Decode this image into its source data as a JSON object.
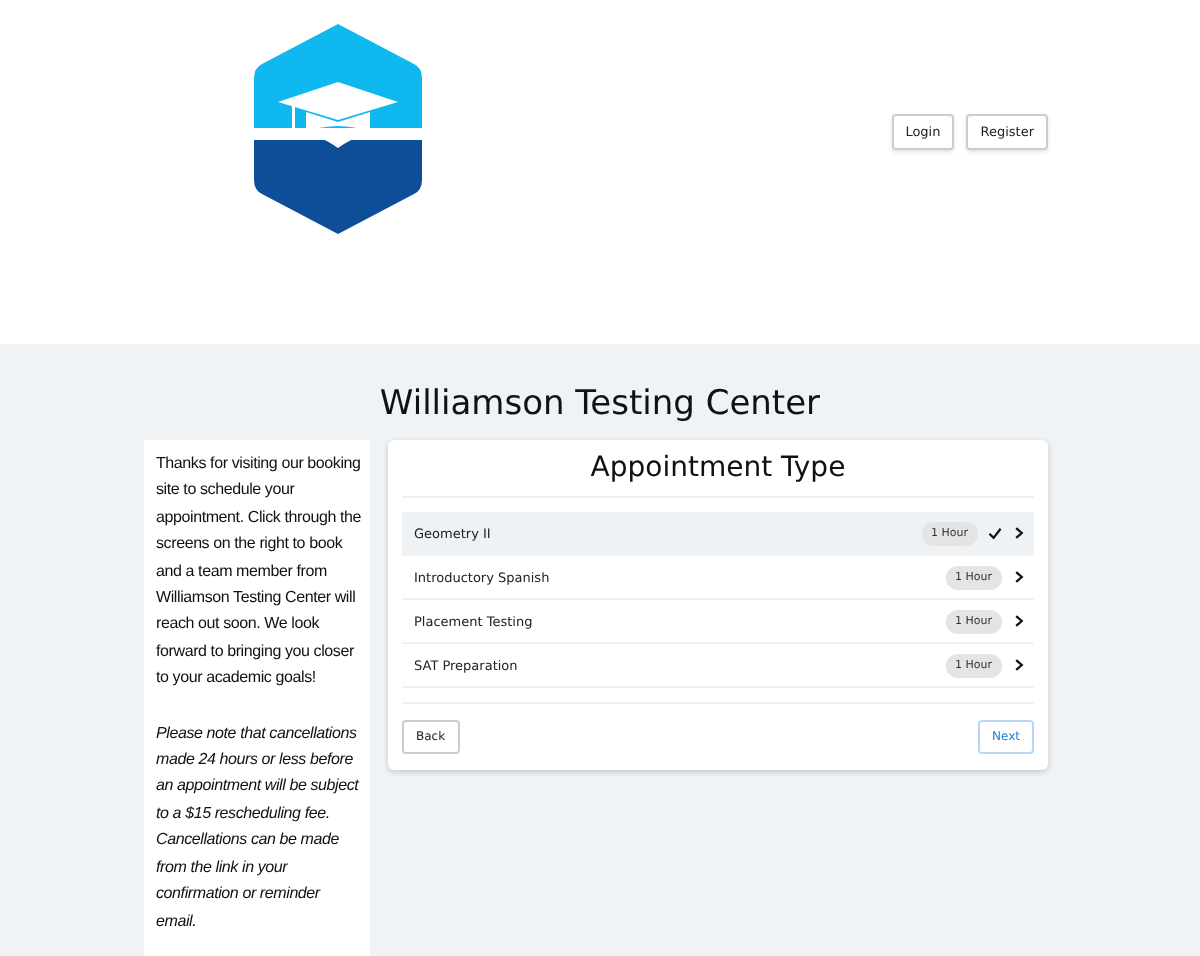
{
  "header": {
    "buttons": [
      "Login",
      "Register"
    ]
  },
  "title": "Williamson Testing Center",
  "sidebar": {
    "intro": "Thanks for visiting our booking site to schedule your appointment. Click through the screens on the right to book and a team member from Williamson Testing Center will reach out soon. We look forward to bringing you closer to your academic goals!",
    "note": "Please note that cancellations made 24 hours or less before an appointment will be subject to a $15 rescheduling fee. Cancellations can be made from the link in your confirmation or reminder email."
  },
  "card": {
    "heading": "Appointment Type",
    "items": [
      {
        "name": "Geometry II",
        "duration": "1 Hour",
        "selected": true
      },
      {
        "name": "Introductory Spanish",
        "duration": "1 Hour",
        "selected": false
      },
      {
        "name": "Placement Testing",
        "duration": "1 Hour",
        "selected": false
      },
      {
        "name": "SAT Preparation",
        "duration": "1 Hour",
        "selected": false
      }
    ],
    "back": "Back",
    "next": "Next"
  }
}
